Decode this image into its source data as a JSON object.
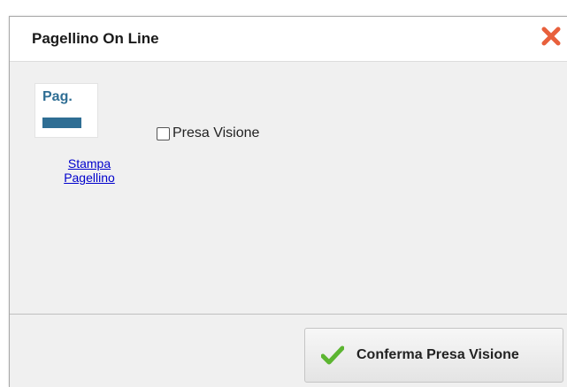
{
  "dialog": {
    "title": "Pagellino On Line",
    "close_icon": "close-icon",
    "close_color": "#e8603c"
  },
  "content": {
    "pag_icon_text": "Pag.",
    "pag_icon_color": "#2f6e94",
    "stampa_link": "Stampa Pagellino",
    "checkbox_label": "Presa Visione",
    "checkbox_checked": false
  },
  "footer": {
    "confirm_label": "Conferma Presa Visione",
    "confirm_icon": "checkmark-icon",
    "confirm_icon_color": "#5cb531"
  }
}
